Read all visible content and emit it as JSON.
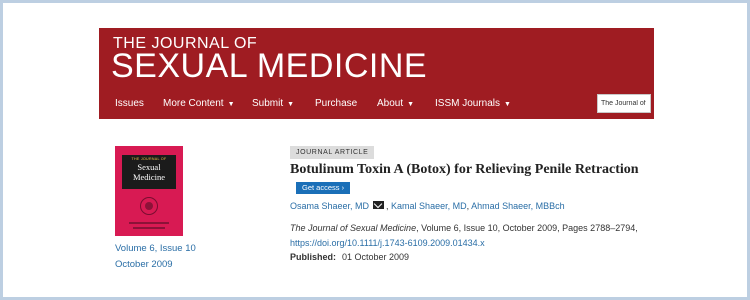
{
  "header": {
    "brand_top": "THE JOURNAL OF",
    "brand_main": "SEXUAL MEDICINE",
    "brand_color": "#9f1c22",
    "nav": [
      {
        "label": "Issues",
        "has_dropdown": false
      },
      {
        "label": "More Content",
        "has_dropdown": true
      },
      {
        "label": "Submit",
        "has_dropdown": true
      },
      {
        "label": "Purchase",
        "has_dropdown": false
      },
      {
        "label": "About",
        "has_dropdown": true
      },
      {
        "label": "ISSM Journals",
        "has_dropdown": true
      }
    ],
    "search_value": "The Journal of Se"
  },
  "cover": {
    "small_text": "THE JOURNAL OF",
    "title_line1": "Sexual",
    "title_line2": "Medicine",
    "color": "#d81a53"
  },
  "issue": {
    "volume_issue": "Volume 6, Issue 10",
    "date": "October 2009"
  },
  "article": {
    "type_badge": "JOURNAL ARTICLE",
    "title": "Botulinum Toxin A (Botox) for Relieving Penile Retraction",
    "access_button": "Get access",
    "access_chevron": "›",
    "authors": [
      {
        "name": "Osama Shaeer, MD",
        "corresponding": true
      },
      {
        "name": "Kamal Shaeer, MD",
        "corresponding": false
      },
      {
        "name": "Ahmad Shaeer, MBBch",
        "corresponding": false
      }
    ],
    "citation_journal": "The Journal of Sexual Medicine",
    "citation_rest": ", Volume 6, Issue 10, October 2009, Pages 2788–2794,",
    "doi": "https://doi.org/10.1111/j.1743-6109.2009.01434.x",
    "published_label": "Published:",
    "published_date": "01 October 2009"
  },
  "icons": {
    "mail": "mail-icon",
    "dropdown": "caret-down-icon"
  }
}
